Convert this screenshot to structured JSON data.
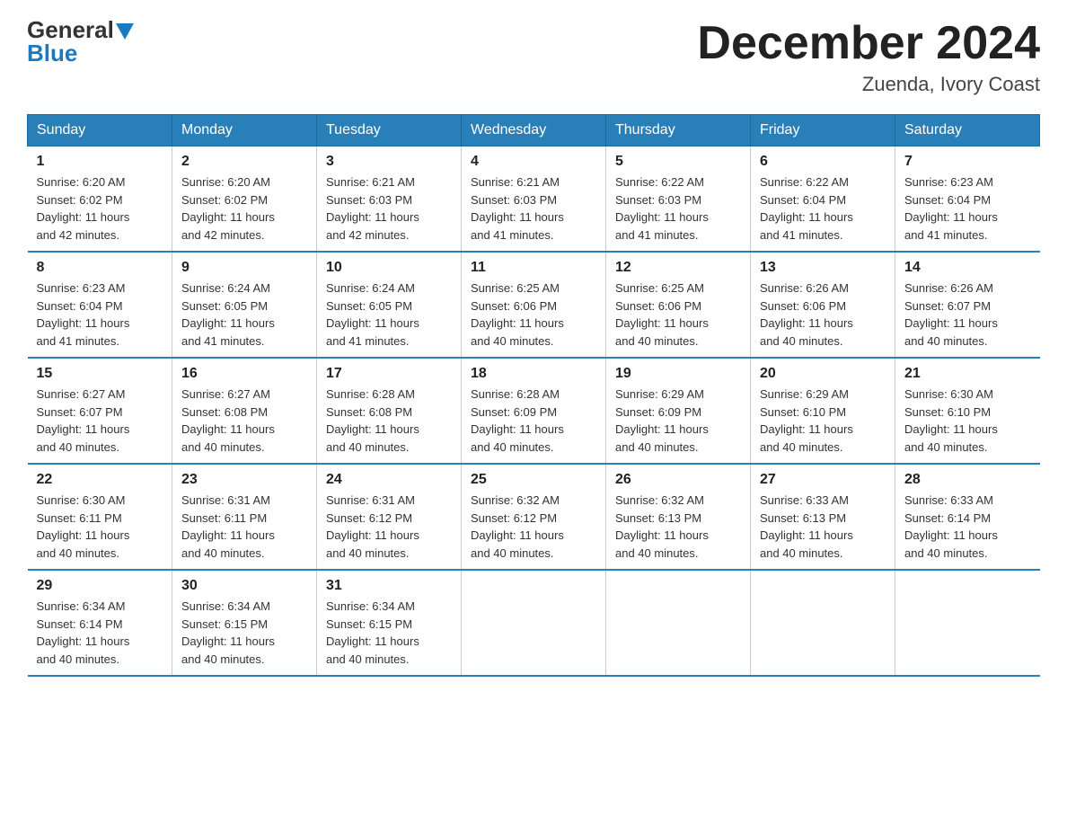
{
  "logo": {
    "general": "General",
    "blue": "Blue"
  },
  "header": {
    "month_title": "December 2024",
    "location": "Zuenda, Ivory Coast"
  },
  "days_of_week": [
    "Sunday",
    "Monday",
    "Tuesday",
    "Wednesday",
    "Thursday",
    "Friday",
    "Saturday"
  ],
  "weeks": [
    [
      {
        "day": "1",
        "sunrise": "6:20 AM",
        "sunset": "6:02 PM",
        "daylight": "11 hours and 42 minutes."
      },
      {
        "day": "2",
        "sunrise": "6:20 AM",
        "sunset": "6:02 PM",
        "daylight": "11 hours and 42 minutes."
      },
      {
        "day": "3",
        "sunrise": "6:21 AM",
        "sunset": "6:03 PM",
        "daylight": "11 hours and 42 minutes."
      },
      {
        "day": "4",
        "sunrise": "6:21 AM",
        "sunset": "6:03 PM",
        "daylight": "11 hours and 41 minutes."
      },
      {
        "day": "5",
        "sunrise": "6:22 AM",
        "sunset": "6:03 PM",
        "daylight": "11 hours and 41 minutes."
      },
      {
        "day": "6",
        "sunrise": "6:22 AM",
        "sunset": "6:04 PM",
        "daylight": "11 hours and 41 minutes."
      },
      {
        "day": "7",
        "sunrise": "6:23 AM",
        "sunset": "6:04 PM",
        "daylight": "11 hours and 41 minutes."
      }
    ],
    [
      {
        "day": "8",
        "sunrise": "6:23 AM",
        "sunset": "6:04 PM",
        "daylight": "11 hours and 41 minutes."
      },
      {
        "day": "9",
        "sunrise": "6:24 AM",
        "sunset": "6:05 PM",
        "daylight": "11 hours and 41 minutes."
      },
      {
        "day": "10",
        "sunrise": "6:24 AM",
        "sunset": "6:05 PM",
        "daylight": "11 hours and 41 minutes."
      },
      {
        "day": "11",
        "sunrise": "6:25 AM",
        "sunset": "6:06 PM",
        "daylight": "11 hours and 40 minutes."
      },
      {
        "day": "12",
        "sunrise": "6:25 AM",
        "sunset": "6:06 PM",
        "daylight": "11 hours and 40 minutes."
      },
      {
        "day": "13",
        "sunrise": "6:26 AM",
        "sunset": "6:06 PM",
        "daylight": "11 hours and 40 minutes."
      },
      {
        "day": "14",
        "sunrise": "6:26 AM",
        "sunset": "6:07 PM",
        "daylight": "11 hours and 40 minutes."
      }
    ],
    [
      {
        "day": "15",
        "sunrise": "6:27 AM",
        "sunset": "6:07 PM",
        "daylight": "11 hours and 40 minutes."
      },
      {
        "day": "16",
        "sunrise": "6:27 AM",
        "sunset": "6:08 PM",
        "daylight": "11 hours and 40 minutes."
      },
      {
        "day": "17",
        "sunrise": "6:28 AM",
        "sunset": "6:08 PM",
        "daylight": "11 hours and 40 minutes."
      },
      {
        "day": "18",
        "sunrise": "6:28 AM",
        "sunset": "6:09 PM",
        "daylight": "11 hours and 40 minutes."
      },
      {
        "day": "19",
        "sunrise": "6:29 AM",
        "sunset": "6:09 PM",
        "daylight": "11 hours and 40 minutes."
      },
      {
        "day": "20",
        "sunrise": "6:29 AM",
        "sunset": "6:10 PM",
        "daylight": "11 hours and 40 minutes."
      },
      {
        "day": "21",
        "sunrise": "6:30 AM",
        "sunset": "6:10 PM",
        "daylight": "11 hours and 40 minutes."
      }
    ],
    [
      {
        "day": "22",
        "sunrise": "6:30 AM",
        "sunset": "6:11 PM",
        "daylight": "11 hours and 40 minutes."
      },
      {
        "day": "23",
        "sunrise": "6:31 AM",
        "sunset": "6:11 PM",
        "daylight": "11 hours and 40 minutes."
      },
      {
        "day": "24",
        "sunrise": "6:31 AM",
        "sunset": "6:12 PM",
        "daylight": "11 hours and 40 minutes."
      },
      {
        "day": "25",
        "sunrise": "6:32 AM",
        "sunset": "6:12 PM",
        "daylight": "11 hours and 40 minutes."
      },
      {
        "day": "26",
        "sunrise": "6:32 AM",
        "sunset": "6:13 PM",
        "daylight": "11 hours and 40 minutes."
      },
      {
        "day": "27",
        "sunrise": "6:33 AM",
        "sunset": "6:13 PM",
        "daylight": "11 hours and 40 minutes."
      },
      {
        "day": "28",
        "sunrise": "6:33 AM",
        "sunset": "6:14 PM",
        "daylight": "11 hours and 40 minutes."
      }
    ],
    [
      {
        "day": "29",
        "sunrise": "6:34 AM",
        "sunset": "6:14 PM",
        "daylight": "11 hours and 40 minutes."
      },
      {
        "day": "30",
        "sunrise": "6:34 AM",
        "sunset": "6:15 PM",
        "daylight": "11 hours and 40 minutes."
      },
      {
        "day": "31",
        "sunrise": "6:34 AM",
        "sunset": "6:15 PM",
        "daylight": "11 hours and 40 minutes."
      },
      null,
      null,
      null,
      null
    ]
  ],
  "labels": {
    "sunrise": "Sunrise:",
    "sunset": "Sunset:",
    "daylight": "Daylight:"
  }
}
